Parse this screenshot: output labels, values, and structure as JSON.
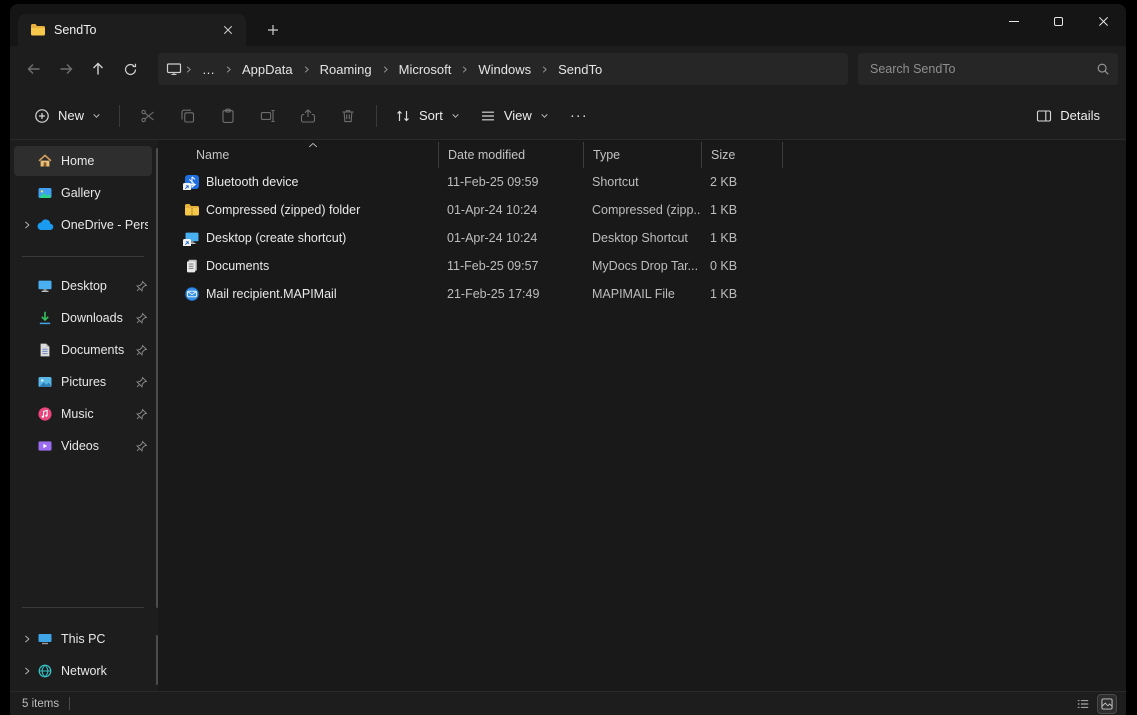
{
  "window": {
    "tab_title": "SendTo"
  },
  "navbar": {
    "overflow": "…",
    "breadcrumb": [
      "AppData",
      "Roaming",
      "Microsoft",
      "Windows",
      "SendTo"
    ],
    "search_placeholder": "Search SendTo"
  },
  "toolbar": {
    "new_label": "New",
    "sort_label": "Sort",
    "view_label": "View",
    "more_label": "···",
    "details_label": "Details"
  },
  "sidebar": {
    "items_top": [
      {
        "label": "Home",
        "icon": "home-icon"
      },
      {
        "label": "Gallery",
        "icon": "gallery-icon"
      },
      {
        "label": "OneDrive - Pers",
        "icon": "onedrive-icon"
      }
    ],
    "pinned": [
      {
        "label": "Desktop",
        "icon": "desktop-icon"
      },
      {
        "label": "Downloads",
        "icon": "downloads-icon"
      },
      {
        "label": "Documents",
        "icon": "documents-icon"
      },
      {
        "label": "Pictures",
        "icon": "pictures-icon"
      },
      {
        "label": "Music",
        "icon": "music-icon"
      },
      {
        "label": "Videos",
        "icon": "videos-icon"
      }
    ],
    "items_bottom": [
      {
        "label": "This PC",
        "icon": "this-pc-icon"
      },
      {
        "label": "Network",
        "icon": "network-icon"
      }
    ]
  },
  "filelist": {
    "columns": [
      "Name",
      "Date modified",
      "Type",
      "Size"
    ],
    "sort": {
      "column": "Name",
      "direction": "ascending"
    },
    "rows": [
      {
        "name": "Bluetooth device",
        "modified": "11-Feb-25 09:59",
        "type": "Shortcut",
        "size": "2 KB",
        "icon": "bluetooth-device-icon"
      },
      {
        "name": "Compressed (zipped) folder",
        "modified": "01-Apr-24 10:24",
        "type": "Compressed (zipp...",
        "size": "1 KB",
        "icon": "zipped-folder-icon"
      },
      {
        "name": "Desktop (create shortcut)",
        "modified": "01-Apr-24 10:24",
        "type": "Desktop Shortcut",
        "size": "1 KB",
        "icon": "desktop-shortcut-icon"
      },
      {
        "name": "Documents",
        "modified": "11-Feb-25 09:57",
        "type": "MyDocs Drop Tar...",
        "size": "0 KB",
        "icon": "documents-target-icon"
      },
      {
        "name": "Mail recipient.MAPIMail",
        "modified": "21-Feb-25 17:49",
        "type": "MAPIMAIL File",
        "size": "1 KB",
        "icon": "mail-recipient-icon"
      }
    ]
  },
  "statusbar": {
    "items_count": "5 items"
  },
  "colors": {
    "folder_yellow": "#f6c74a",
    "accent_blue": "#2f8de4",
    "selected_bg": "#2e2e2e"
  }
}
